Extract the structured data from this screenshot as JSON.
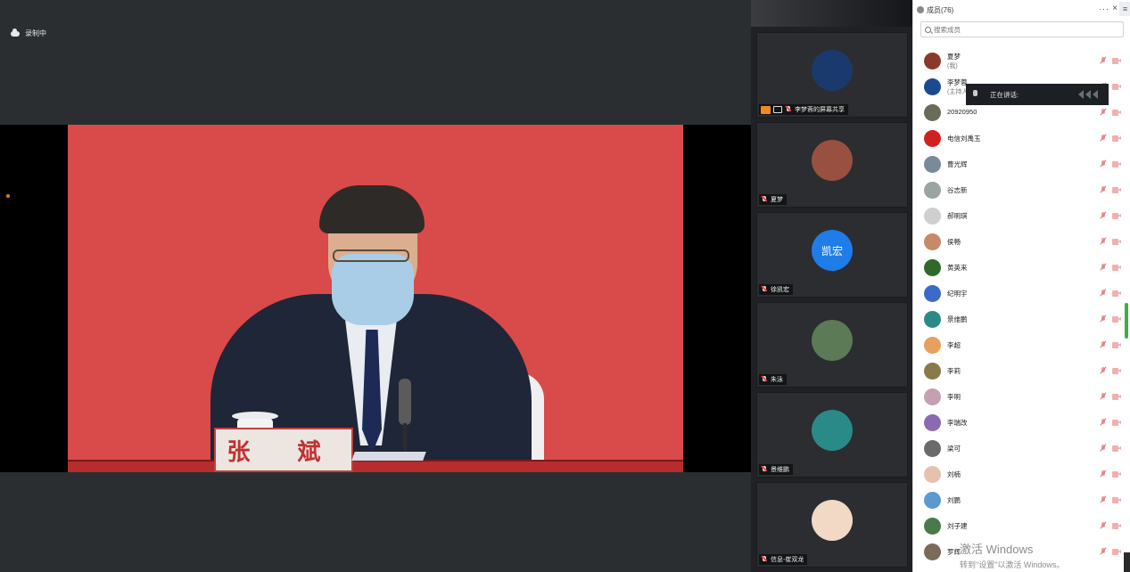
{
  "recording": {
    "label": "录制中"
  },
  "main_video": {
    "nameplate_text": "张 斌"
  },
  "gallery": {
    "tiles": [
      {
        "name": "李梦蓉的屏幕共享",
        "avatar_color": "#1a3a6e"
      },
      {
        "name": "夏梦",
        "avatar_color": "#9a5040"
      },
      {
        "name": "徐凯宏",
        "avatar_text": "凯宏",
        "avatar_color": "#1e7de8"
      },
      {
        "name": "朱泳",
        "avatar_color": "#5b7a55"
      },
      {
        "name": "景维鹏",
        "avatar_color": "#2a8a88"
      },
      {
        "name": "信息-崔双龙",
        "avatar_color": "#f1d9c6"
      }
    ]
  },
  "panel": {
    "title": "成员(76)",
    "dots": "···",
    "close": "×",
    "menu": "≡",
    "search_placeholder": "搜索成员",
    "members": [
      {
        "name": "夏梦",
        "sub": "(我)",
        "color": "#8a3a2a"
      },
      {
        "name": "李梦蓉",
        "sub": "(主持人)",
        "color": "#1b4a8e"
      },
      {
        "name": "20920950",
        "color": "#6b6b5a"
      },
      {
        "name": "电信刘禹玉",
        "color": "#d02020"
      },
      {
        "name": "曹光辉",
        "color": "#7a8a9a"
      },
      {
        "name": "谷志新",
        "color": "#9aa4a0"
      },
      {
        "name": "郝明琪",
        "color": "#cfcfcf"
      },
      {
        "name": "侯畅",
        "color": "#c68a6a"
      },
      {
        "name": "黄英来",
        "color": "#2f6a2a"
      },
      {
        "name": "纪明宇",
        "color": "#3b6ac8"
      },
      {
        "name": "景维鹏",
        "color": "#2a8a88"
      },
      {
        "name": "李超",
        "color": "#e8a060"
      },
      {
        "name": "李莉",
        "color": "#8a7a4a"
      },
      {
        "name": "李明",
        "color": "#c4a0b0"
      },
      {
        "name": "李瑞改",
        "color": "#8a6ab0"
      },
      {
        "name": "梁可",
        "color": "#6a6a6a"
      },
      {
        "name": "刘楠",
        "color": "#e8c0b0"
      },
      {
        "name": "刘鹏",
        "color": "#5a9ad0"
      },
      {
        "name": "刘子建",
        "color": "#4a7a4a"
      },
      {
        "name": "罗辉",
        "color": "#7a6a5a"
      }
    ]
  },
  "speaking": {
    "label": "正在讲话:"
  },
  "watermark": {
    "line1": "激活 Windows",
    "line2": "转到\"设置\"以激活 Windows。"
  }
}
